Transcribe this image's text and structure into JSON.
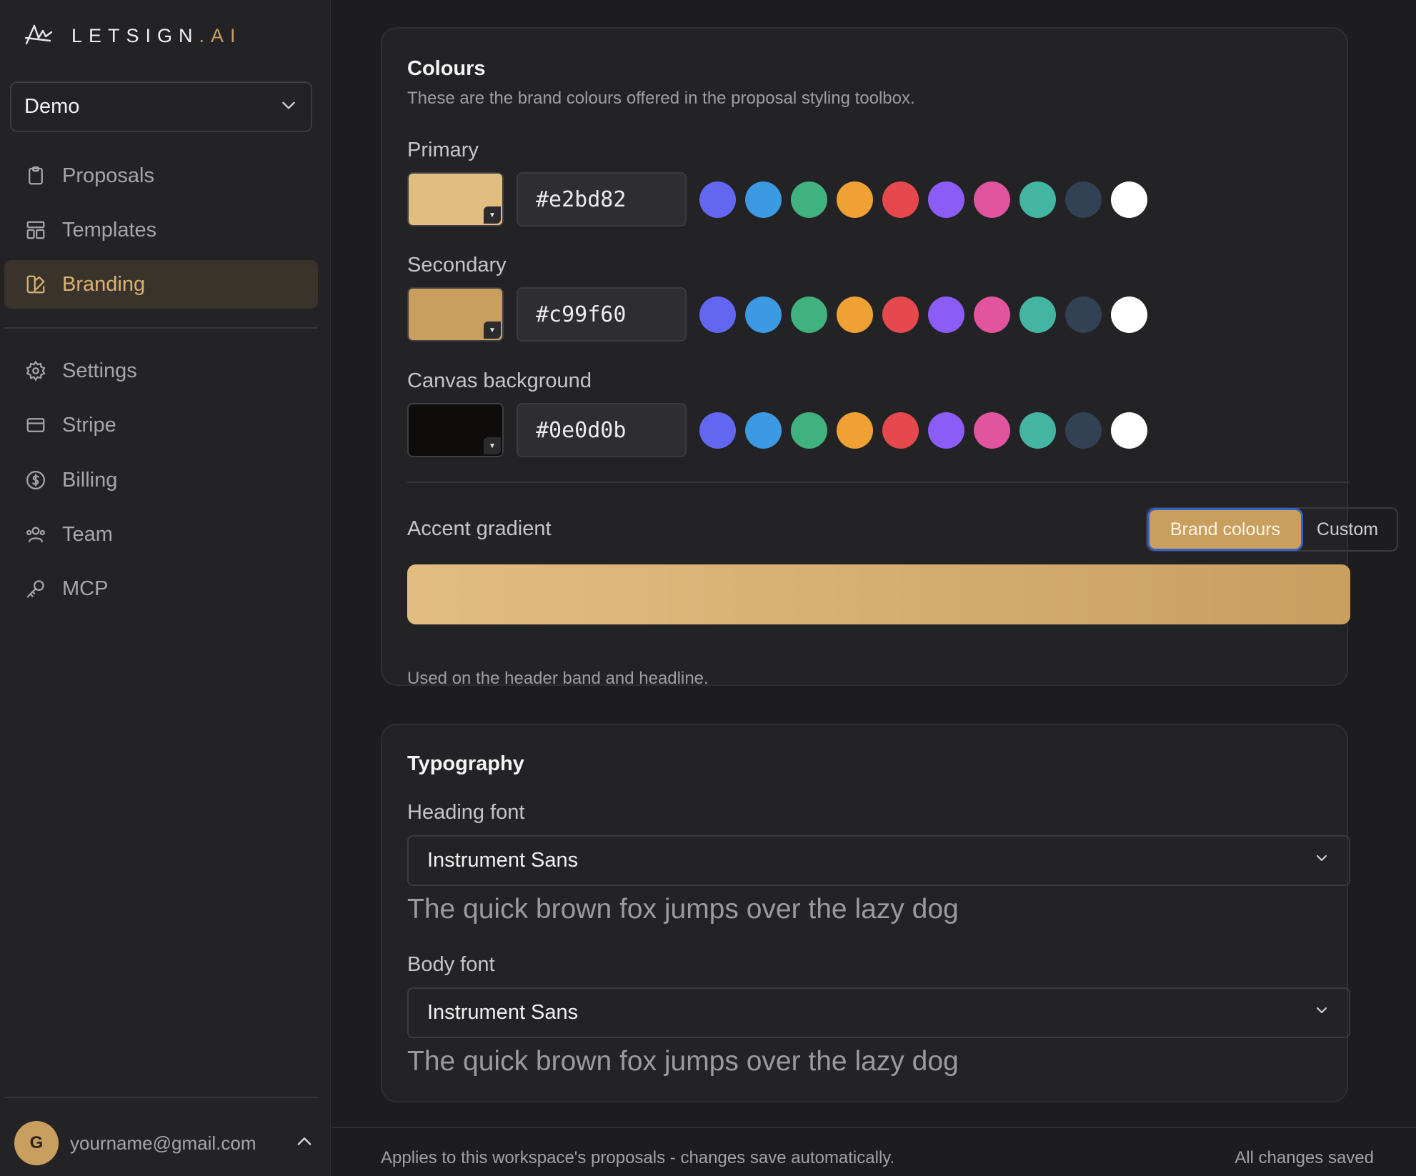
{
  "brand": {
    "logo_main": "LETSIGN",
    "logo_suffix": ".AI"
  },
  "workspace": {
    "label": "Demo"
  },
  "sidebar": {
    "items": [
      {
        "label": "Proposals",
        "icon": "clipboard-icon"
      },
      {
        "label": "Templates",
        "icon": "layout-icon"
      },
      {
        "label": "Branding",
        "icon": "palette-icon",
        "active": true
      },
      {
        "label": "Settings",
        "icon": "gear-icon"
      },
      {
        "label": "Stripe",
        "icon": "card-icon"
      },
      {
        "label": "Billing",
        "icon": "dollar-icon"
      },
      {
        "label": "Team",
        "icon": "team-icon"
      },
      {
        "label": "MCP",
        "icon": "key-icon"
      }
    ]
  },
  "user": {
    "initial": "G",
    "email": "yourname@gmail.com"
  },
  "colours": {
    "title": "Colours",
    "subtitle": "These are the brand colours offered in the proposal styling toolbox.",
    "rows": [
      {
        "label": "Primary",
        "hex": "#e2bd82"
      },
      {
        "label": "Secondary",
        "hex": "#c99f60"
      },
      {
        "label": "Canvas background",
        "hex": "#0e0d0b"
      }
    ],
    "presets": [
      "#6366f1",
      "#3b9ae1",
      "#3fb27f",
      "#f0a133",
      "#e5484d",
      "#8b5cf6",
      "#e0559d",
      "#44b5a3",
      "#334155",
      "#ffffff"
    ]
  },
  "accent": {
    "label": "Accent gradient",
    "options": [
      "Brand colours",
      "Custom"
    ],
    "selected": "Brand colours",
    "gradient_from": "#e2bd82",
    "gradient_to": "#c99f60",
    "note": "Used on the header band and headline."
  },
  "typography": {
    "title": "Typography",
    "heading_label": "Heading font",
    "heading_value": "Instrument Sans",
    "heading_preview": "The quick brown fox jumps over the lazy dog",
    "body_label": "Body font",
    "body_value": "Instrument Sans",
    "body_preview": "The quick brown fox jumps over the lazy dog"
  },
  "footer": {
    "note": "Applies to this workspace's proposals - changes save automatically.",
    "status": "All changes saved"
  }
}
